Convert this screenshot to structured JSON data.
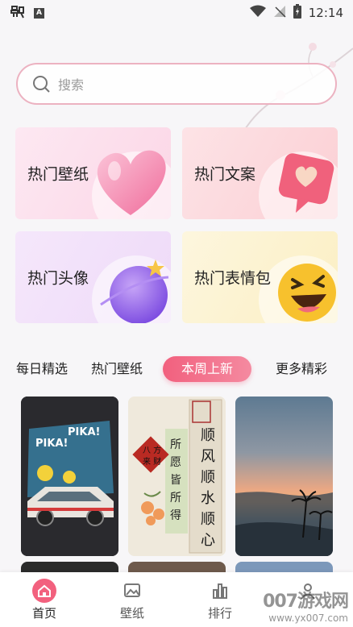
{
  "status_bar": {
    "time": "12:14",
    "left_icons": [
      "bug-icon",
      "a-icon"
    ],
    "right_icons": [
      "wifi-icon",
      "signal-off-icon",
      "battery-charging-icon"
    ]
  },
  "search": {
    "placeholder": "搜索"
  },
  "categories": [
    {
      "label": "热门壁纸",
      "illustration": "pink-heart-icon"
    },
    {
      "label": "热门文案",
      "illustration": "heart-chat-bubble-icon"
    },
    {
      "label": "热门头像",
      "illustration": "purple-planet-icon"
    },
    {
      "label": "热门表情包",
      "illustration": "laughing-emoji-icon"
    }
  ],
  "tabs": [
    "每日精选",
    "热门壁纸",
    "本周上新",
    "更多精彩"
  ],
  "active_tab": "本周上新",
  "wallpapers": [
    {
      "name": "pika-car-poster",
      "text": "PIKA! PIKA!"
    },
    {
      "name": "chinese-calligraphy-poster",
      "text": "所愿皆所得 顺风顺水顺心意 八方来财"
    },
    {
      "name": "sunset-beach-photo",
      "text": ""
    }
  ],
  "bottom_nav": [
    {
      "label": "首页",
      "icon": "home-icon",
      "active": true
    },
    {
      "label": "壁纸",
      "icon": "image-icon",
      "active": false
    },
    {
      "label": "排行",
      "icon": "bar-chart-icon",
      "active": false
    },
    {
      "label": "",
      "icon": "user-icon",
      "active": false
    }
  ],
  "watermark": {
    "main": "007游戏网",
    "sub": "www.yx007.com"
  },
  "colors": {
    "accent": "#f2617e",
    "search_border": "#ecb2c1",
    "background": "#f7f6f8"
  }
}
